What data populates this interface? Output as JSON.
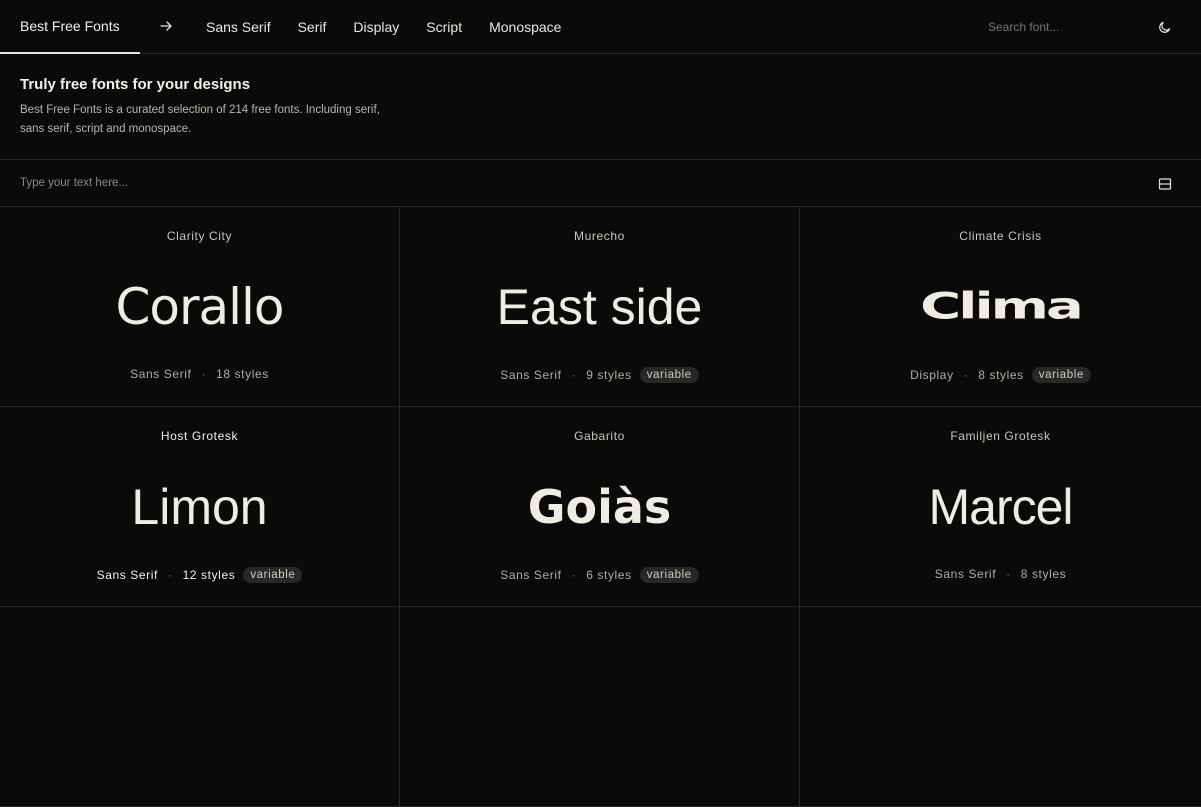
{
  "header": {
    "brand": "Best Free Fonts",
    "nav": [
      "Sans Serif",
      "Serif",
      "Display",
      "Script",
      "Monospace"
    ],
    "search_placeholder": "Search font..."
  },
  "intro": {
    "title": "Truly free fonts for your designs",
    "description": "Best Free Fonts is a curated selection of 214 free fonts. Including serif, sans serif, script and monospace."
  },
  "preview": {
    "placeholder": "Type your text here..."
  },
  "fonts": [
    {
      "name": "Clarity City",
      "sample": "Corallo",
      "category": "Sans Serif",
      "styles": "18 styles",
      "badge": ""
    },
    {
      "name": "Murecho",
      "sample": "East side",
      "category": "Sans Serif",
      "styles": "9 styles",
      "badge": "variable"
    },
    {
      "name": "Climate Crisis",
      "sample": "Clima",
      "category": "Display",
      "styles": "8 styles",
      "badge": "variable"
    },
    {
      "name": "Host Grotesk",
      "sample": "Limon",
      "category": "Sans Serif",
      "styles": "12 styles",
      "badge": "variable"
    },
    {
      "name": "Gabarito",
      "sample": "Goiàs",
      "category": "Sans Serif",
      "styles": "6 styles",
      "badge": "variable"
    },
    {
      "name": "Familjen Grotesk",
      "sample": "Marcel",
      "category": "Sans Serif",
      "styles": "8 styles",
      "badge": ""
    }
  ],
  "icons": {
    "arrow": "arrow-right-icon",
    "theme": "moon-icon",
    "layout": "layout-toggle-icon"
  }
}
